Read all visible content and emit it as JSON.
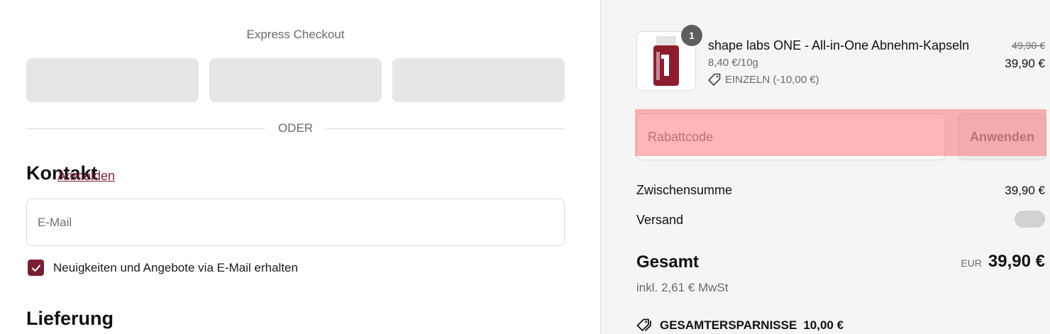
{
  "express": {
    "title": "Express Checkout",
    "divider_text": "ODER"
  },
  "contact": {
    "title": "Kontakt",
    "login_link": "Anmelden",
    "email_placeholder": "E-Mail",
    "newsletter_label": "Neuigkeiten und Angebote via E-Mail erhalten",
    "newsletter_checked": true
  },
  "delivery": {
    "title": "Lieferung"
  },
  "cart": {
    "item": {
      "quantity": "1",
      "name": "shape labs ONE - All-in-One Abnehm-Kapseln",
      "unit_price": "8,40 €/10g",
      "discount_label": "EINZELN (-10,00 €)",
      "price_original": "49,90 €",
      "price_current": "39,90 €",
      "image_icon": "capsule-bottle-icon"
    },
    "discount": {
      "placeholder": "Rabattcode",
      "apply_label": "Anwenden"
    },
    "summary": {
      "subtotal_label": "Zwischensumme",
      "subtotal_value": "39,90 €",
      "shipping_label": "Versand",
      "total_label": "Gesamt",
      "total_currency": "EUR",
      "total_value": "39,90 €",
      "tax_note": "inkl. 2,61 € MwSt",
      "savings_label": "GESAMTERSPARNISSE",
      "savings_value": "10,00 €"
    }
  },
  "colors": {
    "accent": "#7a1f33",
    "summary_bg": "#f5f5f5",
    "express_button": "#e6e6e6",
    "highlight": "#ff5050"
  }
}
